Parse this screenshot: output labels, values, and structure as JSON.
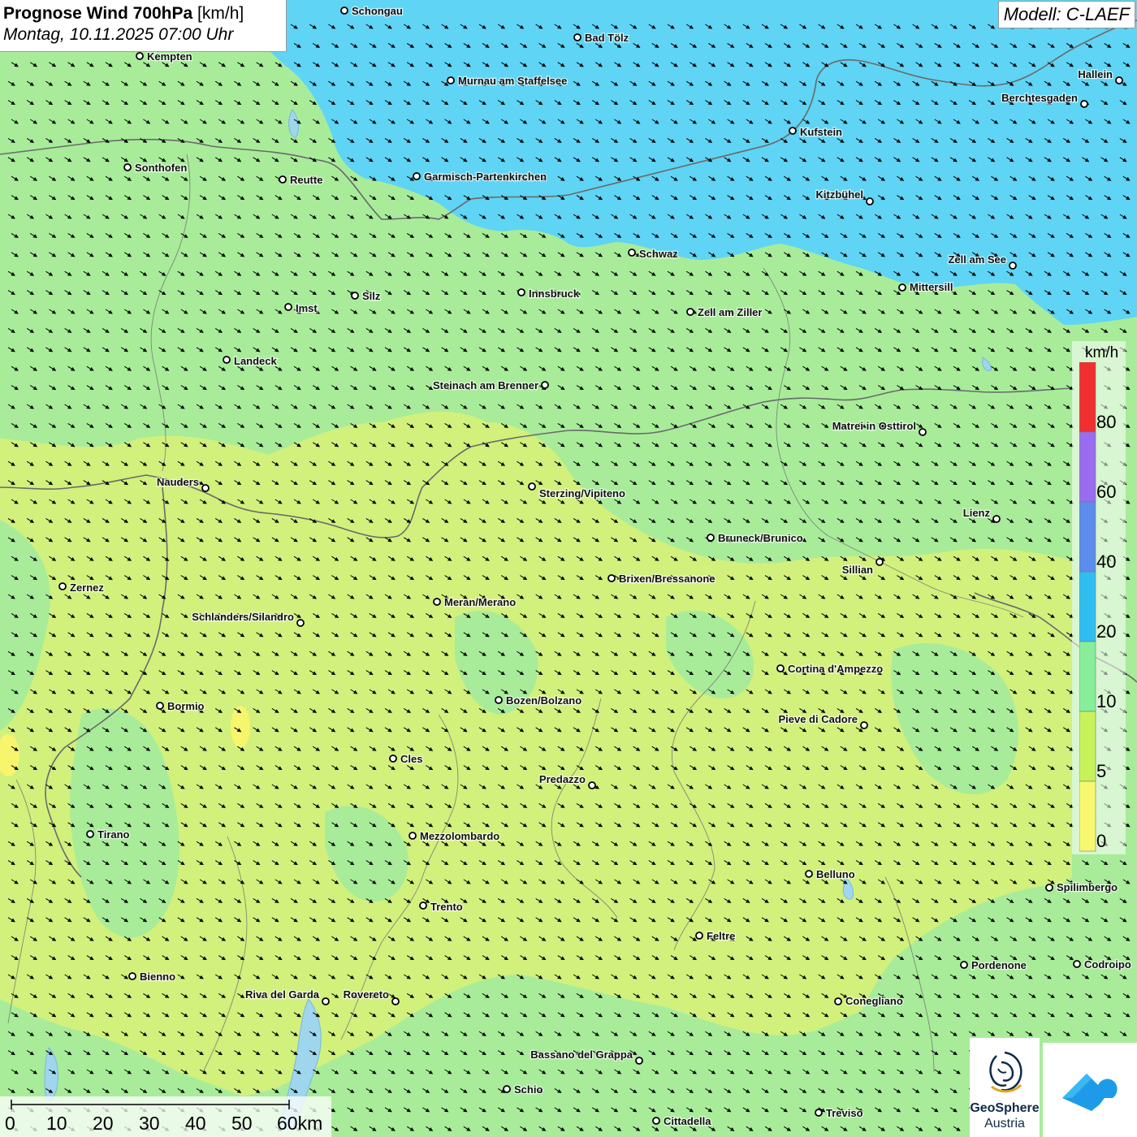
{
  "title": {
    "main": "Prognose Wind 700hPa",
    "unit": "[km/h]",
    "datetime": "Montag, 10.11.2025 07:00 Uhr"
  },
  "model": "Modell: C-LAEF",
  "legend": {
    "unit": "km/h",
    "ticks": [
      "80",
      "60",
      "40",
      "20",
      "10",
      "5",
      "0"
    ],
    "colors": [
      "#f03030",
      "#9a6cf0",
      "#5c8cec",
      "#30bef0",
      "#88ee9a",
      "#c8f25a",
      "#f8f870"
    ]
  },
  "scale_bar": {
    "labels": [
      "0",
      "10",
      "20",
      "30",
      "40",
      "50",
      "60km"
    ]
  },
  "logo": {
    "name_line1": "GeoSphere",
    "name_line2": "Austria"
  },
  "wind_arrows": {
    "direction": "toward southeast",
    "color": "#000000"
  },
  "cities": [
    {
      "name": "Schongau"
    },
    {
      "name": "Bad Tölz"
    },
    {
      "name": "Kempten"
    },
    {
      "name": "Murnau am Staffelsee"
    },
    {
      "name": "Hallein"
    },
    {
      "name": "Berchtesgaden"
    },
    {
      "name": "Kufstein"
    },
    {
      "name": "Sonthofen"
    },
    {
      "name": "Reutte"
    },
    {
      "name": "Garmisch-Partenkirchen"
    },
    {
      "name": "Kitzbühel"
    },
    {
      "name": "Schwaz"
    },
    {
      "name": "Zell am See"
    },
    {
      "name": "Mittersill"
    },
    {
      "name": "Innsbruck"
    },
    {
      "name": "Silz"
    },
    {
      "name": "Imst"
    },
    {
      "name": "Zell am Ziller"
    },
    {
      "name": "Landeck"
    },
    {
      "name": "Steinach am Brenner"
    },
    {
      "name": "Matrei in Osttirol"
    },
    {
      "name": "Nauders"
    },
    {
      "name": "Sterzing/Vipiteno"
    },
    {
      "name": "Lienz"
    },
    {
      "name": "Bruneck/Brunico"
    },
    {
      "name": "Sillian"
    },
    {
      "name": "Brixen/Bressanone"
    },
    {
      "name": "Zernez"
    },
    {
      "name": "Meran/Merano"
    },
    {
      "name": "Schlanders/Silandro"
    },
    {
      "name": "Cortina d'Ampezzo"
    },
    {
      "name": "Bozen/Bolzano"
    },
    {
      "name": "Bormio"
    },
    {
      "name": "Pieve di Cadore"
    },
    {
      "name": "Cles"
    },
    {
      "name": "Predazzo"
    },
    {
      "name": "Tirano"
    },
    {
      "name": "Mezzolombardo"
    },
    {
      "name": "Belluno"
    },
    {
      "name": "Spilimbergo"
    },
    {
      "name": "Trento"
    },
    {
      "name": "Feltre"
    },
    {
      "name": "Pordenone"
    },
    {
      "name": "Codroipo"
    },
    {
      "name": "Bienno"
    },
    {
      "name": "Riva del Garda"
    },
    {
      "name": "Rovereto"
    },
    {
      "name": "Conegliano"
    },
    {
      "name": "Bassano del Grappa"
    },
    {
      "name": "Schio"
    },
    {
      "name": "Treviso"
    },
    {
      "name": "Cittadella"
    }
  ]
}
